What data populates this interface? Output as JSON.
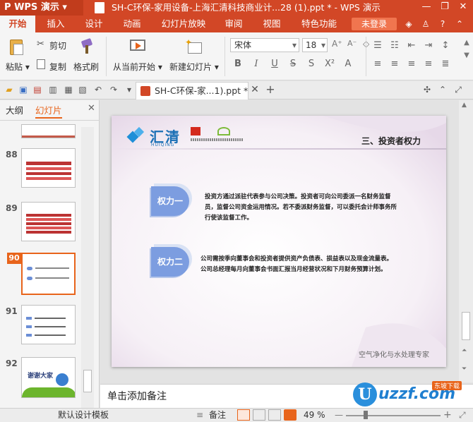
{
  "app": {
    "name": "WPS 演示",
    "document_title": "SH-C环保-家用设备-上海汇清科技商业计...28 (1).ppt * - WPS 演示"
  },
  "menu": {
    "tabs": [
      "开始",
      "插入",
      "设计",
      "动画",
      "幻灯片放映",
      "审阅",
      "视图",
      "特色功能"
    ],
    "active": "开始",
    "login": "未登录"
  },
  "ribbon": {
    "paste": "粘贴",
    "cut": "剪切",
    "copy": "复制",
    "format_painter": "格式刷",
    "from_current": "从当前开始",
    "new_slide": "新建幻灯片",
    "font_name": "宋体",
    "font_size": "18",
    "format_buttons": [
      "B",
      "I",
      "U",
      "S"
    ]
  },
  "doc_tab": {
    "label": "SH-C环保-家...1).ppt *"
  },
  "left_pane": {
    "tabs": [
      "大纲",
      "幻灯片"
    ],
    "active_tab": "幻灯片",
    "slides": [
      {
        "num": "88",
        "selected": false
      },
      {
        "num": "89",
        "selected": false
      },
      {
        "num": "90",
        "selected": true
      },
      {
        "num": "91",
        "selected": false
      },
      {
        "num": "92",
        "selected": false,
        "thumb_text": "谢谢大家"
      }
    ]
  },
  "slide": {
    "logo_text": "汇清",
    "logo_sub": "HUIQING",
    "heading": "三、投资者权力",
    "right1": {
      "label": "权力一",
      "text": "投资方通过派驻代表参与公司决策。投资者可向公司委派一名财务监督员，监督公司资金运用情况。若不委派财务监督，可以委托会计师事务所行使该监督工作。"
    },
    "right2": {
      "label": "权力二",
      "text": "公司需按季向董事会和投资者提供资产负债表、损益表以及现金流量表。公司总经理每月向董事会书面汇报当月经营状况和下月财务预算计划。"
    },
    "footer": "空气净化与水处理专家"
  },
  "notes": {
    "placeholder": "单击添加备注"
  },
  "status": {
    "template": "默认设计模板",
    "notes": "备注",
    "zoom": "49 %"
  },
  "watermark": {
    "text": "uzzf.com",
    "tagline": "东坡下载"
  },
  "colors": {
    "brand": "#d24726",
    "accent": "#e8641b",
    "badge": "#6b8ed6"
  }
}
